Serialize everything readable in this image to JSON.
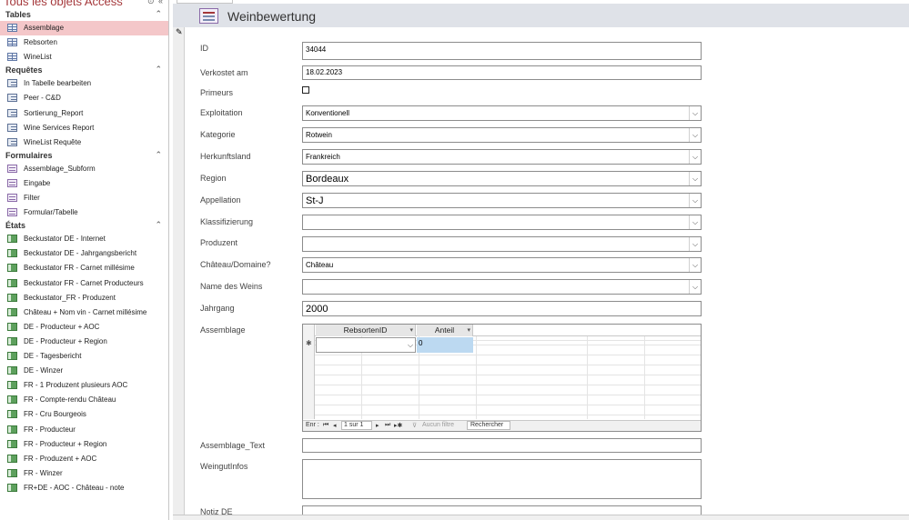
{
  "nav": {
    "title": "Tous les objets Access",
    "search_icon": "search-icon",
    "collapse_icon": "chevron-double-left-icon",
    "sections": [
      {
        "label": "Tables",
        "items": [
          {
            "label": "Assemblage",
            "icon": "table-icon",
            "selected": true
          },
          {
            "label": "Rebsorten",
            "icon": "table-icon"
          },
          {
            "label": "WineList",
            "icon": "table-icon"
          }
        ]
      },
      {
        "label": "Requêtes",
        "items": [
          {
            "label": "In Tabelle bearbeiten",
            "icon": "query-icon"
          },
          {
            "label": "Peer - C&D",
            "icon": "query-icon"
          },
          {
            "label": "Sortierung_Report",
            "icon": "query-icon"
          },
          {
            "label": "Wine Services Report",
            "icon": "query-icon"
          },
          {
            "label": "WineList Requête",
            "icon": "query-icon"
          }
        ]
      },
      {
        "label": "Formulaires",
        "items": [
          {
            "label": "Assemblage_Subform",
            "icon": "form-icon"
          },
          {
            "label": "Eingabe",
            "icon": "form-icon"
          },
          {
            "label": "Filter",
            "icon": "form-icon"
          },
          {
            "label": "Formular/Tabelle",
            "icon": "form-icon"
          }
        ]
      },
      {
        "label": "États",
        "items": [
          {
            "label": "Beckustator DE - Internet",
            "icon": "report-icon"
          },
          {
            "label": "Beckustator DE - Jahrgangsbericht",
            "icon": "report-icon"
          },
          {
            "label": "Beckustator FR - Carnet millésime",
            "icon": "report-icon"
          },
          {
            "label": "Beckustator FR - Carnet Producteurs",
            "icon": "report-icon"
          },
          {
            "label": "Beckustator_FR - Produzent",
            "icon": "report-icon"
          },
          {
            "label": "Château + Nom vin - Carnet millésime",
            "icon": "report-icon"
          },
          {
            "label": "DE - Producteur + AOC",
            "icon": "report-icon"
          },
          {
            "label": "DE - Producteur + Region",
            "icon": "report-icon"
          },
          {
            "label": "DE - Tagesbericht",
            "icon": "report-icon"
          },
          {
            "label": "DE - Winzer",
            "icon": "report-icon"
          },
          {
            "label": "FR - 1 Produzent plusieurs AOC",
            "icon": "report-icon"
          },
          {
            "label": "FR - Compte-rendu Château",
            "icon": "report-icon"
          },
          {
            "label": "FR - Cru Bourgeois",
            "icon": "report-icon"
          },
          {
            "label": "FR - Producteur",
            "icon": "report-icon"
          },
          {
            "label": "FR - Producteur + Region",
            "icon": "report-icon"
          },
          {
            "label": "FR - Produzent + AOC",
            "icon": "report-icon"
          },
          {
            "label": "FR - Winzer",
            "icon": "report-icon"
          },
          {
            "label": "FR+DE - AOC - Château - note",
            "icon": "report-icon"
          }
        ]
      }
    ]
  },
  "form": {
    "title": "Weinbewertung",
    "icon": "form-icon",
    "fields": [
      {
        "label": "ID",
        "value": "34044",
        "type": "text"
      },
      {
        "label": "Verkostet am",
        "value": "18.02.2023",
        "type": "text"
      },
      {
        "label": "Primeurs",
        "value": false,
        "type": "checkbox"
      },
      {
        "label": "Exploitation",
        "value": "Konventionell",
        "type": "combo"
      },
      {
        "label": "Kategorie",
        "value": "Rotwein",
        "type": "combo"
      },
      {
        "label": "Herkunftsland",
        "value": "Frankreich",
        "type": "combo"
      },
      {
        "label": "Region",
        "value": "Bordeaux",
        "type": "combo",
        "large": true
      },
      {
        "label": "Appellation",
        "value": "St-J",
        "type": "combo",
        "large": true
      },
      {
        "label": "Klassifizierung",
        "value": "",
        "type": "combo"
      },
      {
        "label": "Produzent",
        "value": "",
        "type": "combo"
      },
      {
        "label": "Château/Domaine?",
        "value": "Château",
        "type": "combo"
      },
      {
        "label": "Name des Weins",
        "value": "",
        "type": "combo"
      },
      {
        "label": "Jahrgang",
        "value": "2000",
        "type": "text",
        "large": true
      },
      {
        "label": "Assemblage",
        "type": "subform"
      },
      {
        "label": "Assemblage_Text",
        "value": "",
        "type": "text"
      },
      {
        "label": "WeingutInfos",
        "value": "",
        "type": "memo"
      },
      {
        "label": "Notiz DE",
        "value": "",
        "type": "text"
      }
    ]
  },
  "subform": {
    "columns": [
      "RebsortenID",
      "Anteil"
    ],
    "new_row": {
      "RebsortenID": "",
      "Anteil": "0"
    },
    "record_nav": {
      "label": "Enr :",
      "position": "1 sur 1",
      "filter": "Aucun filtre",
      "search": "Rechercher"
    }
  }
}
